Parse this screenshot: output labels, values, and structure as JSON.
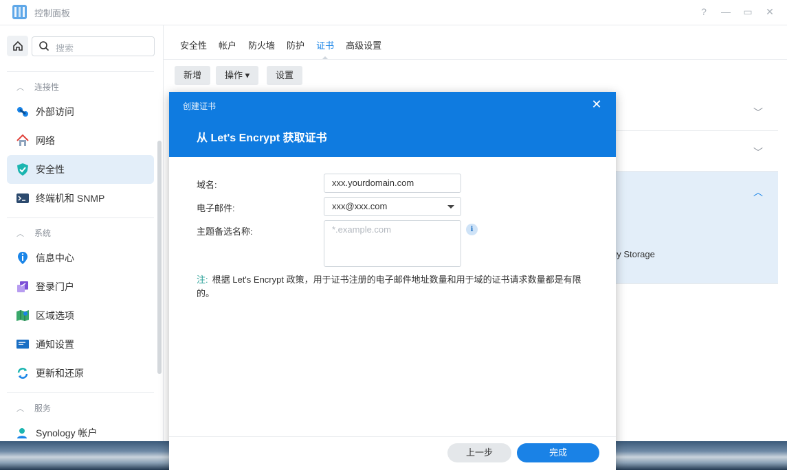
{
  "window": {
    "title": "控制面板",
    "controls": [
      "?",
      "—",
      "▭",
      "✕"
    ]
  },
  "sidebar": {
    "search_placeholder": "搜索",
    "groups": [
      {
        "label": "连接性",
        "items": [
          {
            "label": "外部访问",
            "icon": "external-access-icon"
          },
          {
            "label": "网络",
            "icon": "network-house-icon"
          },
          {
            "label": "安全性",
            "icon": "shield-check-icon",
            "active": true
          },
          {
            "label": "终端机和 SNMP",
            "icon": "terminal-icon"
          }
        ]
      },
      {
        "label": "系统",
        "items": [
          {
            "label": "信息中心",
            "icon": "info-icon"
          },
          {
            "label": "登录门户",
            "icon": "login-portal-icon"
          },
          {
            "label": "区域选项",
            "icon": "region-map-icon"
          },
          {
            "label": "通知设置",
            "icon": "notification-icon"
          },
          {
            "label": "更新和还原",
            "icon": "update-restore-icon"
          }
        ]
      },
      {
        "label": "服务",
        "items": [
          {
            "label": "Synology 帐户",
            "icon": "synology-account-icon"
          }
        ]
      }
    ]
  },
  "main": {
    "tabs": [
      "安全性",
      "帐户",
      "防火墙",
      "防护",
      "证书",
      "高级设置"
    ],
    "active_tab": "证书",
    "toolbar": {
      "add": "新增",
      "action": "操作 ▾",
      "settings": "设置"
    },
    "background_text": "gy Storage"
  },
  "dialog": {
    "header_small": "创建证书",
    "title": "从 Let's Encrypt 获取证书",
    "fields": {
      "domain_label": "域名:",
      "domain_value": "xxx.yourdomain.com",
      "email_label": "电子邮件:",
      "email_value": "xxx@xxx.com",
      "san_label": "主题备选名称:",
      "san_placeholder": "*.example.com"
    },
    "note_prefix": "注:",
    "note_text": "根据 Let's Encrypt 政策，用于证书注册的电子邮件地址数量和用于域的证书请求数量都是有限的。",
    "buttons": {
      "prev": "上一步",
      "done": "完成"
    }
  },
  "colors": {
    "accent": "#0f7be0",
    "active_bg": "#e3eef9",
    "note": "#2aa198"
  }
}
